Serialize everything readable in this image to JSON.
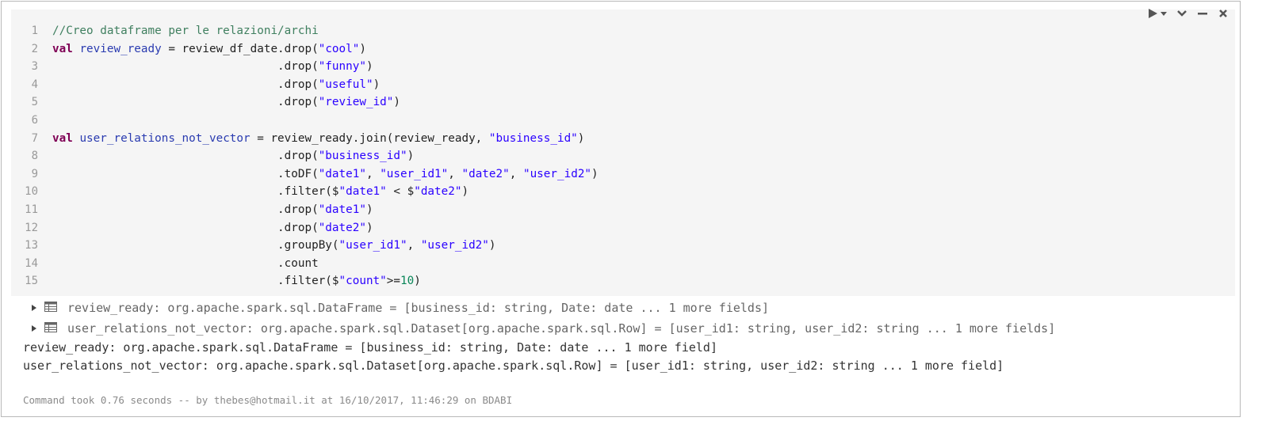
{
  "toolbar": {
    "run_icon": "play-dropdown-icon",
    "collapse_icon": "chevron-down-icon",
    "minimize_icon": "minus-icon",
    "close_icon": "close-icon"
  },
  "code": {
    "line_numbers": [
      "1",
      "2",
      "3",
      "4",
      "5",
      "6",
      "7",
      "8",
      "9",
      "10",
      "11",
      "12",
      "13",
      "14",
      "15"
    ],
    "lines": [
      [
        {
          "t": "//Creo dataframe per le relazioni/archi",
          "c": "cm"
        }
      ],
      [
        {
          "t": "val",
          "c": "kw"
        },
        {
          "t": " ",
          "c": ""
        },
        {
          "t": "review_ready",
          "c": "vn"
        },
        {
          "t": " = review_df_date.drop(",
          "c": ""
        },
        {
          "t": "\"cool\"",
          "c": "st"
        },
        {
          "t": ")",
          "c": ""
        }
      ],
      [
        {
          "t": "                                 .drop(",
          "c": ""
        },
        {
          "t": "\"funny\"",
          "c": "st"
        },
        {
          "t": ")",
          "c": ""
        }
      ],
      [
        {
          "t": "                                 .drop(",
          "c": ""
        },
        {
          "t": "\"useful\"",
          "c": "st"
        },
        {
          "t": ")",
          "c": ""
        }
      ],
      [
        {
          "t": "                                 .drop(",
          "c": ""
        },
        {
          "t": "\"review_id\"",
          "c": "st"
        },
        {
          "t": ")",
          "c": ""
        }
      ],
      [
        {
          "t": "",
          "c": ""
        }
      ],
      [
        {
          "t": "val",
          "c": "kw"
        },
        {
          "t": " ",
          "c": ""
        },
        {
          "t": "user_relations_not_vector",
          "c": "vn"
        },
        {
          "t": " = review_ready.join(review_ready, ",
          "c": ""
        },
        {
          "t": "\"business_id\"",
          "c": "st"
        },
        {
          "t": ")",
          "c": ""
        }
      ],
      [
        {
          "t": "                                 .drop(",
          "c": ""
        },
        {
          "t": "\"business_id\"",
          "c": "st"
        },
        {
          "t": ")",
          "c": ""
        }
      ],
      [
        {
          "t": "                                 .toDF(",
          "c": ""
        },
        {
          "t": "\"date1\"",
          "c": "st"
        },
        {
          "t": ", ",
          "c": ""
        },
        {
          "t": "\"user_id1\"",
          "c": "st"
        },
        {
          "t": ", ",
          "c": ""
        },
        {
          "t": "\"date2\"",
          "c": "st"
        },
        {
          "t": ", ",
          "c": ""
        },
        {
          "t": "\"user_id2\"",
          "c": "st"
        },
        {
          "t": ")",
          "c": ""
        }
      ],
      [
        {
          "t": "                                 .filter($",
          "c": ""
        },
        {
          "t": "\"date1\"",
          "c": "st"
        },
        {
          "t": " < $",
          "c": ""
        },
        {
          "t": "\"date2\"",
          "c": "st"
        },
        {
          "t": ")",
          "c": ""
        }
      ],
      [
        {
          "t": "                                 .drop(",
          "c": ""
        },
        {
          "t": "\"date1\"",
          "c": "st"
        },
        {
          "t": ")",
          "c": ""
        }
      ],
      [
        {
          "t": "                                 .drop(",
          "c": ""
        },
        {
          "t": "\"date2\"",
          "c": "st"
        },
        {
          "t": ")",
          "c": ""
        }
      ],
      [
        {
          "t": "                                 .groupBy(",
          "c": ""
        },
        {
          "t": "\"user_id1\"",
          "c": "st"
        },
        {
          "t": ", ",
          "c": ""
        },
        {
          "t": "\"user_id2\"",
          "c": "st"
        },
        {
          "t": ")",
          "c": ""
        }
      ],
      [
        {
          "t": "                                 .count",
          "c": ""
        }
      ],
      [
        {
          "t": "                                 .filter($",
          "c": ""
        },
        {
          "t": "\"count\"",
          "c": "st"
        },
        {
          "t": ">=",
          "c": ""
        },
        {
          "t": "10",
          "c": "nm"
        },
        {
          "t": ")",
          "c": ""
        }
      ]
    ]
  },
  "results": {
    "expandable": [
      {
        "text": "review_ready: org.apache.spark.sql.DataFrame = [business_id: string, Date: date ... 1 more fields]",
        "icon": "table-icon"
      },
      {
        "text": "user_relations_not_vector: org.apache.spark.sql.Dataset[org.apache.spark.sql.Row] = [user_id1: string, user_id2: string ... 1 more fields]",
        "icon": "table-icon"
      }
    ],
    "output_lines": [
      "review_ready: org.apache.spark.sql.DataFrame = [business_id: string, Date: date ... 1 more field]",
      "user_relations_not_vector: org.apache.spark.sql.Dataset[org.apache.spark.sql.Row] = [user_id1: string, user_id2: string ... 1 more field]"
    ]
  },
  "footer": {
    "text": "Command took 0.76 seconds -- by thebes@hotmail.it at 16/10/2017, 11:46:29 on BDABI"
  },
  "colors": {
    "comment": "#3f7f5f",
    "keyword": "#7f0055",
    "variable": "#2a3bb0",
    "string": "#2a00ff",
    "number": "#098658",
    "editor_bg": "#f5f5f5"
  }
}
